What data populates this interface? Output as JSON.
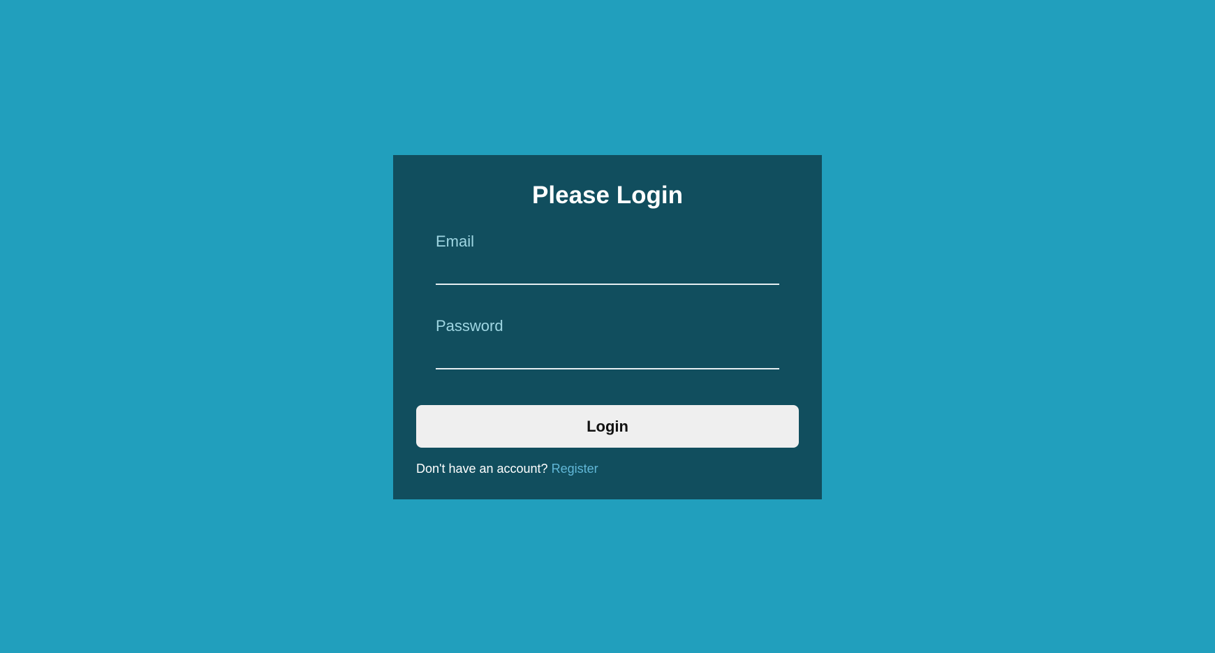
{
  "colors": {
    "background": "#219fbd",
    "card": "#114e5e",
    "button": "#efefef",
    "link": "#62b8d8",
    "label": "#9fd6e2"
  },
  "login_form": {
    "title": "Please Login",
    "email": {
      "label": "Email",
      "value": ""
    },
    "password": {
      "label": "Password",
      "value": ""
    },
    "submit_label": "Login",
    "register_prompt": "Don't have an account?",
    "register_link": "Register"
  }
}
